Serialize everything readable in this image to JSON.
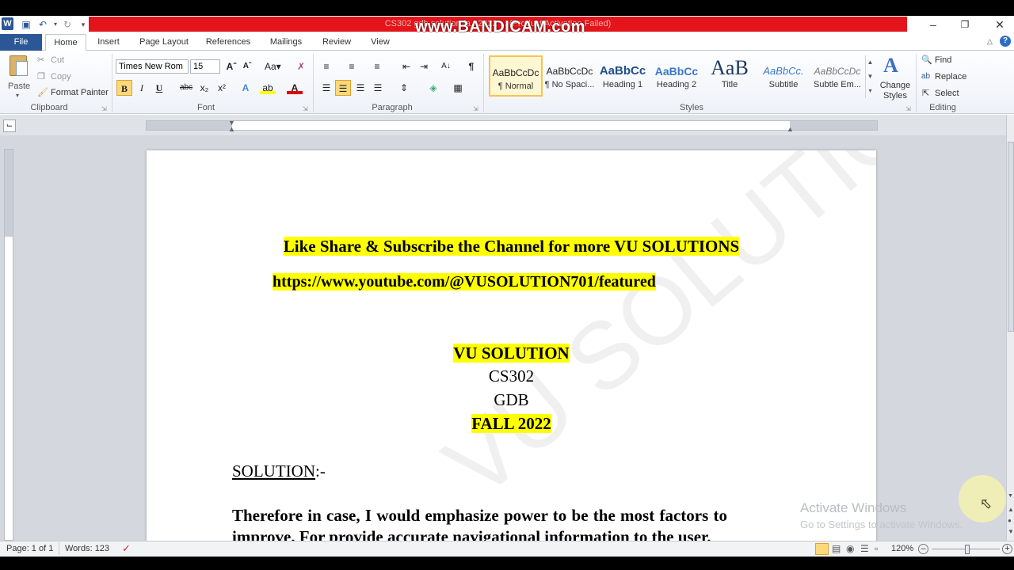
{
  "window": {
    "title": "CS302 gdb solution fa...2022 ... (Product Activation Failed)",
    "recorder_watermark": "www.BANDICAM.com",
    "app_badge": "W"
  },
  "ribbon_tabs": {
    "file": "File",
    "home": "Home",
    "insert": "Insert",
    "page_layout": "Page Layout",
    "references": "References",
    "mailings": "Mailings",
    "review": "Review",
    "view": "View"
  },
  "clipboard": {
    "paste": "Paste",
    "cut": "Cut",
    "copy": "Copy",
    "format_painter": "Format Painter",
    "label": "Clipboard"
  },
  "font": {
    "name": "Times New Rom",
    "size": "15",
    "label": "Font",
    "bold": "B",
    "italic": "I",
    "underline": "U",
    "strike": "abc",
    "subscript": "x₂",
    "superscript": "x²"
  },
  "paragraph": {
    "label": "Paragraph",
    "pilcrow": "¶"
  },
  "styles": {
    "label": "Styles",
    "items": [
      {
        "sample": "AaBbCcDc",
        "name": "¶ Normal"
      },
      {
        "sample": "AaBbCcDc",
        "name": "¶ No Spaci..."
      },
      {
        "sample": "AaBbCc",
        "name": "Heading 1"
      },
      {
        "sample": "AaBbCc",
        "name": "Heading 2"
      },
      {
        "sample": "AaB",
        "name": "Title"
      },
      {
        "sample": "AaBbCc.",
        "name": "Subtitle"
      },
      {
        "sample": "AaBbCcDc",
        "name": "Subtle Em..."
      }
    ],
    "change_styles": "Change Styles"
  },
  "editing": {
    "find": "Find",
    "replace": "Replace",
    "select": "Select",
    "label": "Editing"
  },
  "document": {
    "line1": "Like Share & Subscribe the Channel for more VU SOLUTIONS",
    "line2": "https://www.youtube.com/@VUSOLUTION701/featured",
    "brand": "VU SOLUTION",
    "course": "CS302",
    "type": "GDB",
    "term": "FALL 2022",
    "solution_heading": "SOLUTION",
    "solution_suffix": ":-",
    "para_line1": "Therefore in case, I would emphasize power to be the most factors to",
    "para_line2": "improve. For provide accurate navigational information to the user.",
    "page_watermark": "VU SOLUTION"
  },
  "activation": {
    "title": "Activate Windows",
    "subtitle": "Go to Settings to activate Windows."
  },
  "status": {
    "page": "Page: 1 of 1",
    "words": "Words: 123",
    "zoom": "120%"
  }
}
